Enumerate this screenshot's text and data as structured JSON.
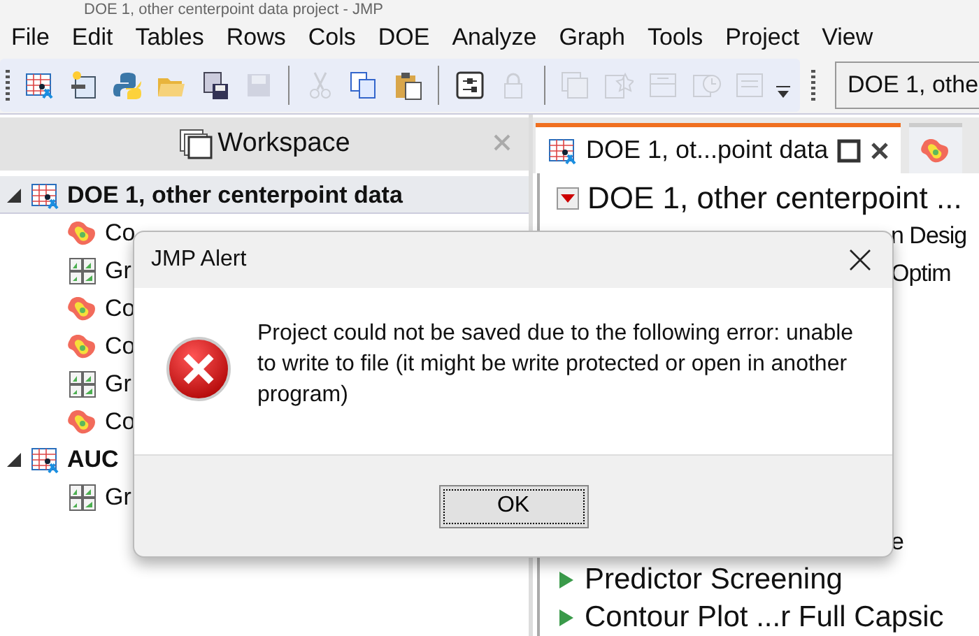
{
  "window": {
    "title": "DOE 1, other centerpoint data project - JMP"
  },
  "menu": [
    "File",
    "Edit",
    "Tables",
    "Rows",
    "Cols",
    "DOE",
    "Analyze",
    "Graph",
    "Tools",
    "Project",
    "View"
  ],
  "toolbar": {
    "buttons": [
      {
        "kind": "table",
        "disabled": false
      },
      {
        "kind": "script",
        "disabled": false
      },
      {
        "kind": "python",
        "disabled": false
      },
      {
        "kind": "folder",
        "disabled": false
      },
      {
        "kind": "saveas",
        "disabled": false
      },
      {
        "kind": "save",
        "disabled": true
      },
      {
        "kind": "sep"
      },
      {
        "kind": "cut",
        "disabled": true
      },
      {
        "kind": "copy",
        "disabled": false
      },
      {
        "kind": "paste",
        "disabled": false
      },
      {
        "kind": "sep"
      },
      {
        "kind": "sliders",
        "disabled": false
      },
      {
        "kind": "lock",
        "disabled": true
      },
      {
        "kind": "sep"
      },
      {
        "kind": "windows",
        "disabled": true
      },
      {
        "kind": "star",
        "disabled": true
      },
      {
        "kind": "tray",
        "disabled": true
      },
      {
        "kind": "clock",
        "disabled": true
      },
      {
        "kind": "panel",
        "disabled": true
      }
    ],
    "combo": "DOE 1, othe"
  },
  "workspace": {
    "title": "Workspace",
    "tree": [
      {
        "label": "DOE 1, other centerpoint data",
        "kind": "table",
        "expanded": true,
        "selected": true,
        "children": [
          {
            "label": "Co",
            "kind": "contour",
            "selected": false
          },
          {
            "label": "Gr",
            "kind": "graph",
            "selected": false
          },
          {
            "label": "Co",
            "kind": "contour",
            "selected": false
          },
          {
            "label": "Co",
            "kind": "contour",
            "selected": false
          },
          {
            "label": "Gr",
            "kind": "graph",
            "selected": false
          },
          {
            "label": "Co",
            "kind": "contour",
            "selected": false
          }
        ]
      },
      {
        "label": "AUC",
        "kind": "table",
        "expanded": true,
        "selected": false,
        "children": [
          {
            "label": "Gr",
            "kind": "graph",
            "selected": false
          }
        ]
      }
    ]
  },
  "tabs": [
    {
      "label": "DOE 1, ot...point data",
      "kind": "table",
      "selected": true
    },
    {
      "kind": "contour",
      "selected": false
    }
  ],
  "report": {
    "top": [
      {
        "kind": "outline",
        "text": "DOE 1, other centerpoint ...",
        "expanded": true
      },
      {
        "kind": "fragment",
        "text": "n Desig"
      },
      {
        "kind": "fragment",
        "text": "Optim"
      }
    ],
    "bottom": [
      {
        "kind": "fragment",
        "text": "e"
      },
      {
        "kind": "outline",
        "text": "Predictor Screening",
        "expanded": false
      },
      {
        "kind": "outline",
        "text": "Contour Plot ...r Full Capsic",
        "expanded": false
      }
    ]
  },
  "dialog": {
    "title": "JMP Alert",
    "message": "Project could not be saved due to the following error: unable to write to file (it might be write protected or open in another program)",
    "button": "OK"
  }
}
